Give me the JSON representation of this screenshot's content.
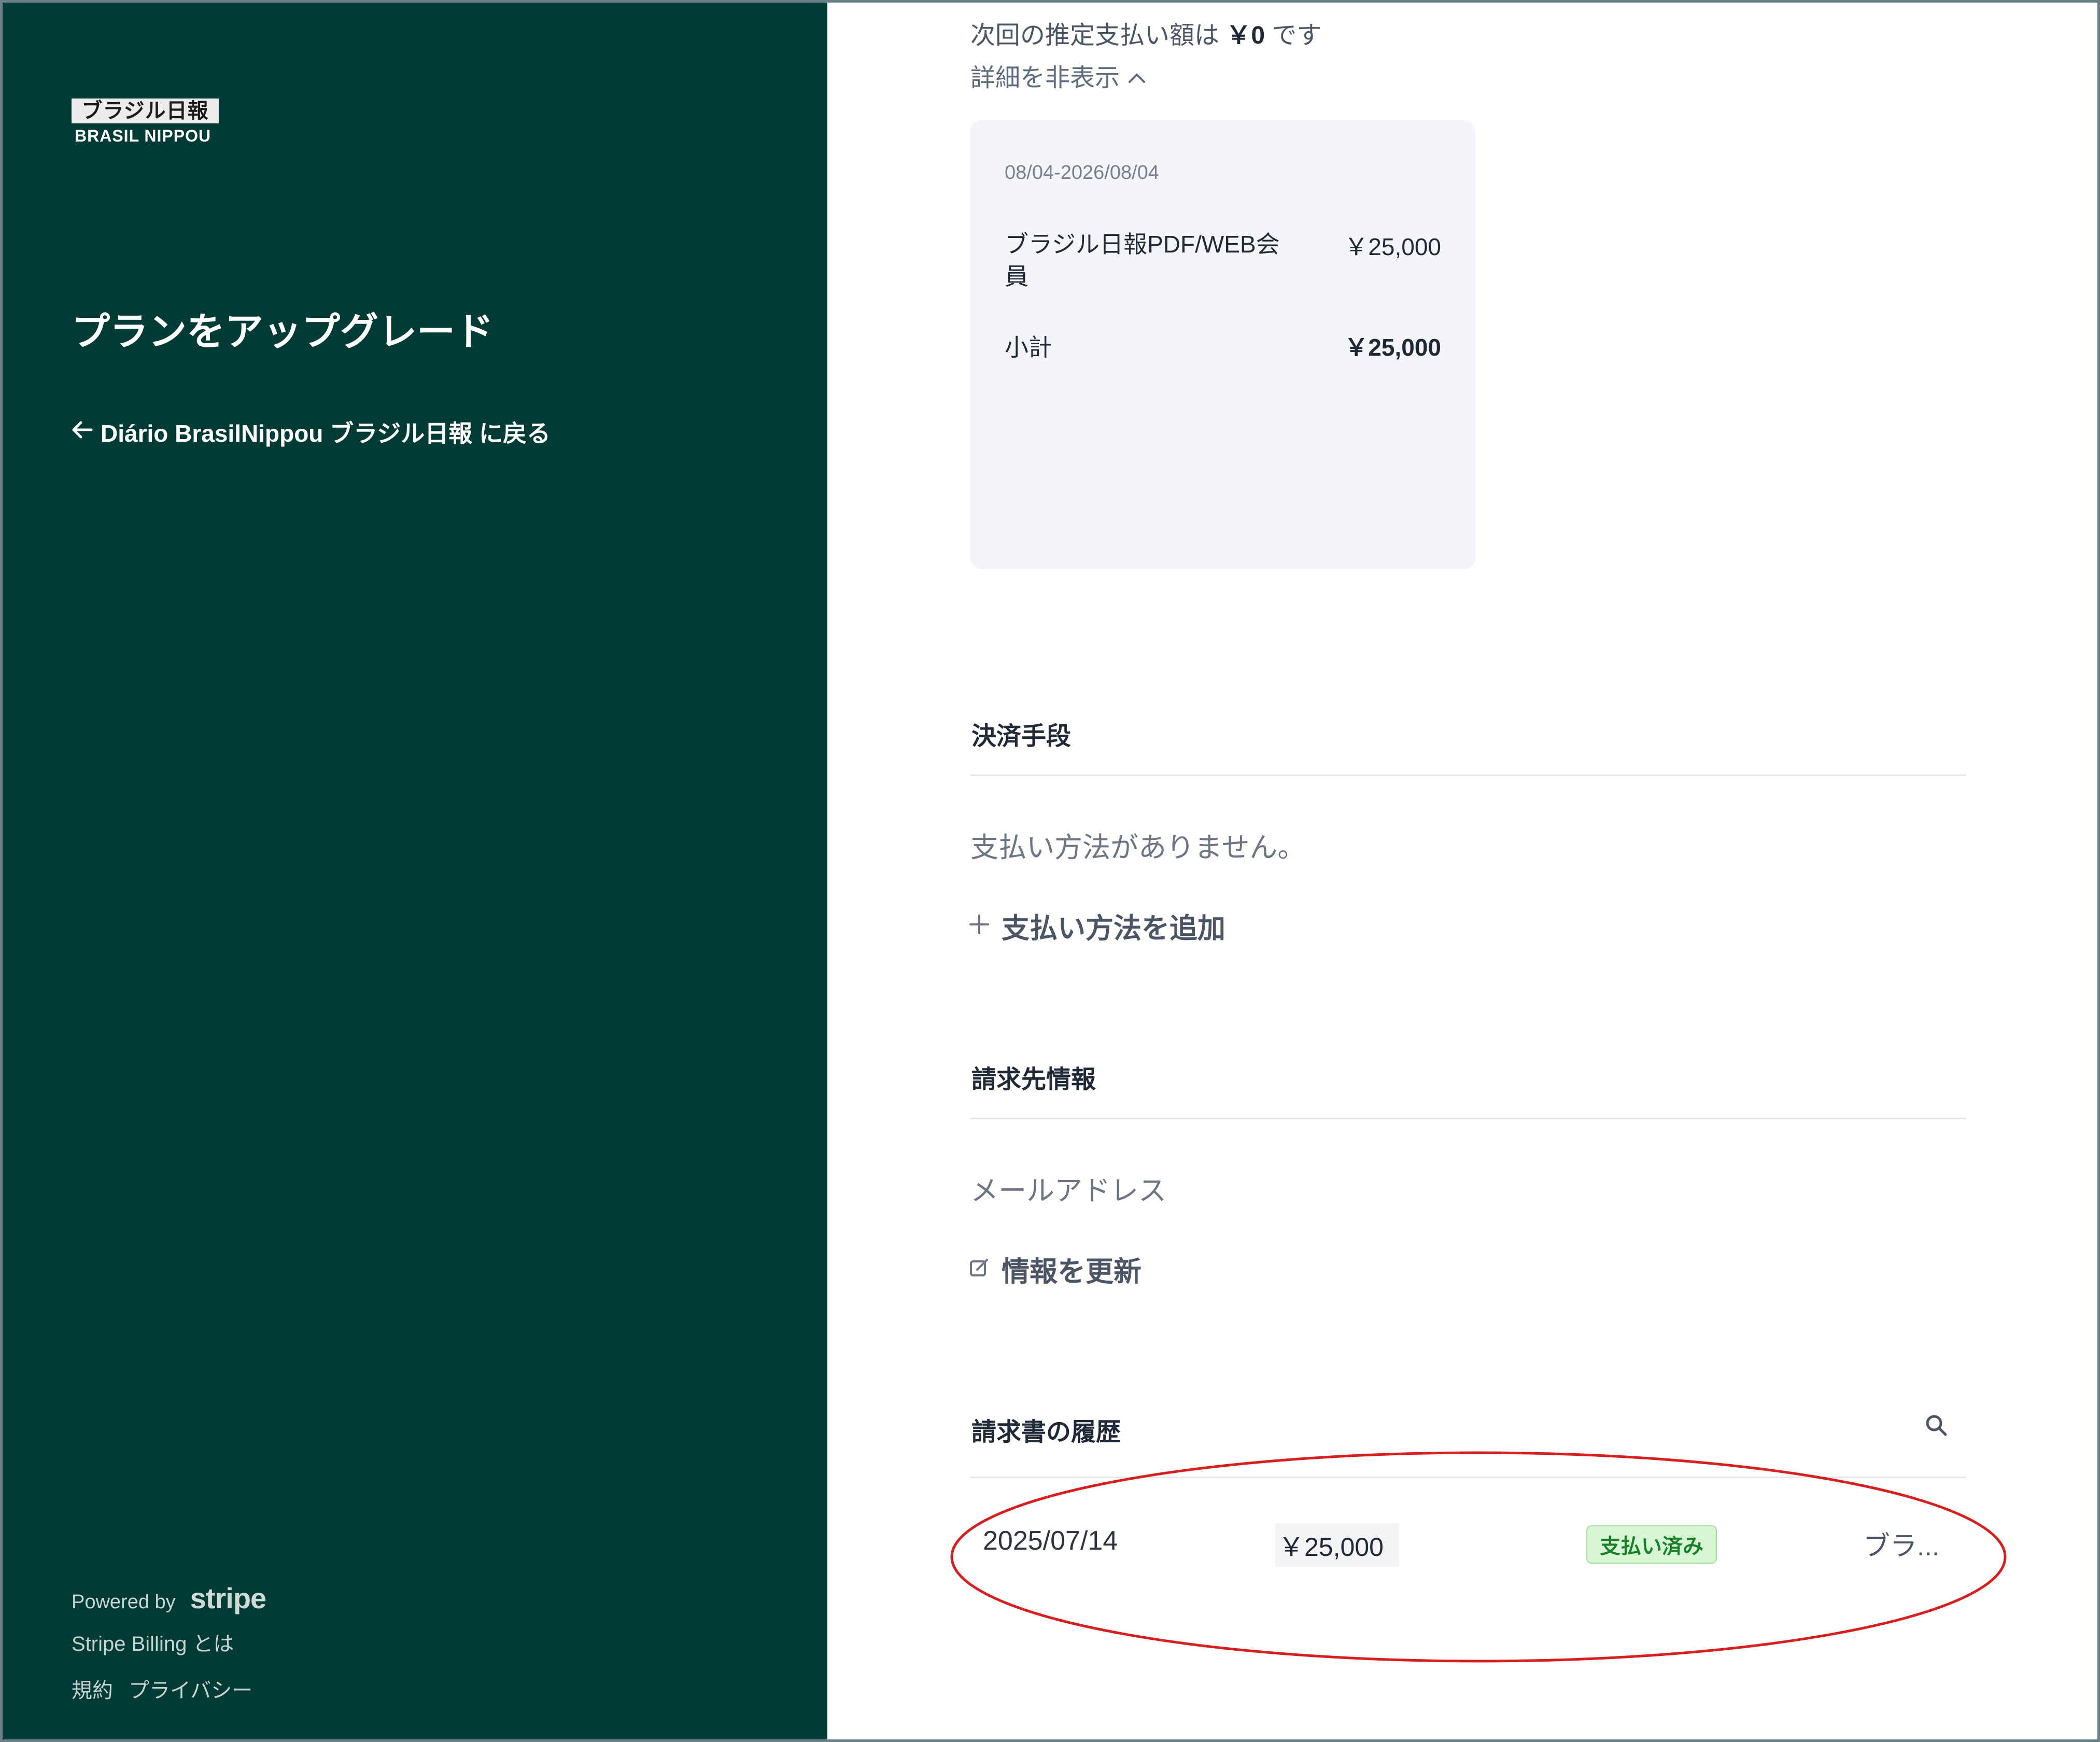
{
  "sidebar": {
    "logo_jp": "ブラジル日報",
    "logo_en": "BRASIL NIPPOU",
    "title": "プランをアップグレード",
    "back_link": "Diário BrasilNippou ブラジル日報 に戻る",
    "powered_by": "Powered by",
    "stripe_wordmark": "stripe",
    "billing_link": "Stripe Billing とは",
    "footer_links": [
      "規約",
      "プライバシー"
    ]
  },
  "summary": {
    "next_payment_prefix": "次回の推定支払い額は",
    "next_payment_amount": "￥0",
    "next_payment_suffix": "です",
    "toggle_details": "詳細を非表示",
    "period": "08/04-2026/08/04",
    "item_name": "ブラジル日報PDF/WEB会員",
    "item_price": "￥25,000",
    "subtotal_label": "小計",
    "subtotal_value": "￥25,000"
  },
  "payment": {
    "title": "決済手段",
    "empty_text": "支払い方法がありません。",
    "add_label": "支払い方法を追加"
  },
  "billing_info": {
    "title": "請求先情報",
    "email_label": "メールアドレス",
    "update_label": "情報を更新"
  },
  "invoices": {
    "title": "請求書の履歴",
    "rows": [
      {
        "date": "2025/07/14",
        "amount": "￥25,000",
        "status": "支払い済み",
        "description": "ブラ..."
      }
    ]
  },
  "colors": {
    "sidebar_bg": "#003b35",
    "paid_badge_bg": "#d6f5d3",
    "paid_badge_text": "#1a7f2a",
    "highlight_ellipse": "#d81e1e"
  }
}
